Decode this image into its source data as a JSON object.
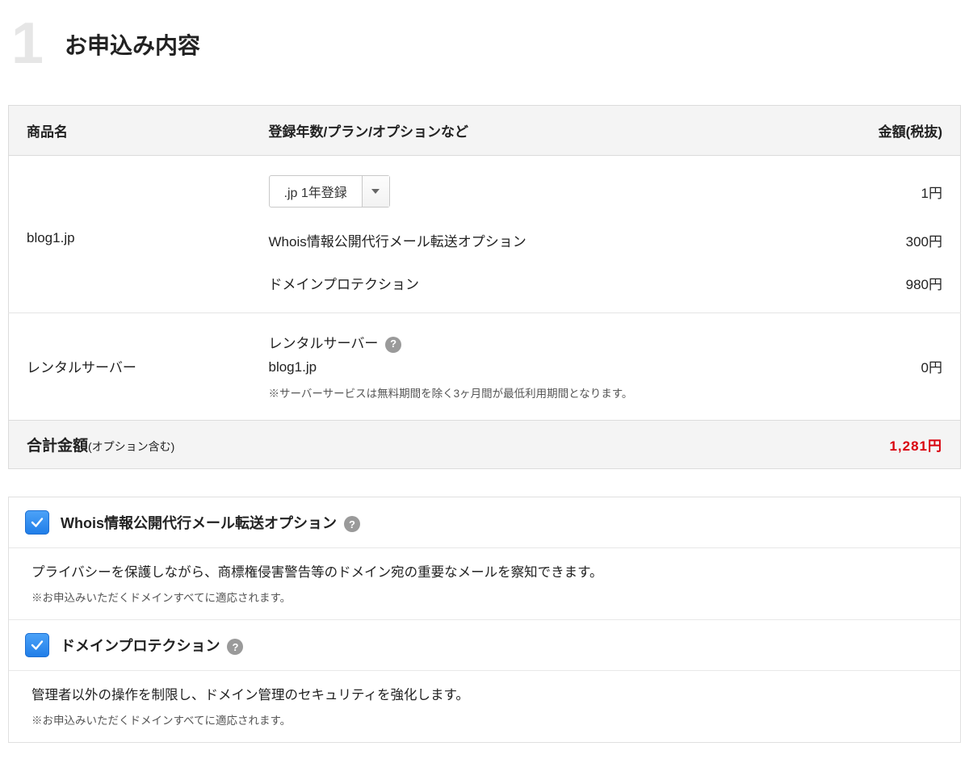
{
  "step_number": "1",
  "page_title": "お申込み内容",
  "table": {
    "headers": {
      "product": "商品名",
      "detail": "登録年数/プラン/オプションなど",
      "amount": "金額(税抜)"
    },
    "rows": [
      {
        "product": "blog1.jp",
        "lines": [
          {
            "type": "select",
            "value": ".jp 1年登録",
            "price": "1円"
          },
          {
            "type": "text",
            "value": "Whois情報公開代行メール転送オプション",
            "price": "300円"
          },
          {
            "type": "text",
            "value": "ドメインプロテクション",
            "price": "980円"
          }
        ]
      },
      {
        "product": "レンタルサーバー",
        "server": {
          "label": "レンタルサーバー",
          "domain": "blog1.jp",
          "note": "※サーバーサービスは無料期間を除く3ヶ月間が最低利用期間となります。",
          "price": "0円"
        }
      }
    ],
    "total": {
      "label": "合計金額",
      "sub": "(オプション含む)",
      "amount": "1,281円"
    }
  },
  "options": [
    {
      "checked": true,
      "title": "Whois情報公開代行メール転送オプション",
      "desc": "プライバシーを保護しながら、商標権侵害警告等のドメイン宛の重要なメールを察知できます。",
      "note": "※お申込みいただくドメインすべてに適応されます。"
    },
    {
      "checked": true,
      "title": "ドメインプロテクション",
      "desc": "管理者以外の操作を制限し、ドメイン管理のセキュリティを強化します。",
      "note": "※お申込みいただくドメインすべてに適応されます。"
    }
  ]
}
